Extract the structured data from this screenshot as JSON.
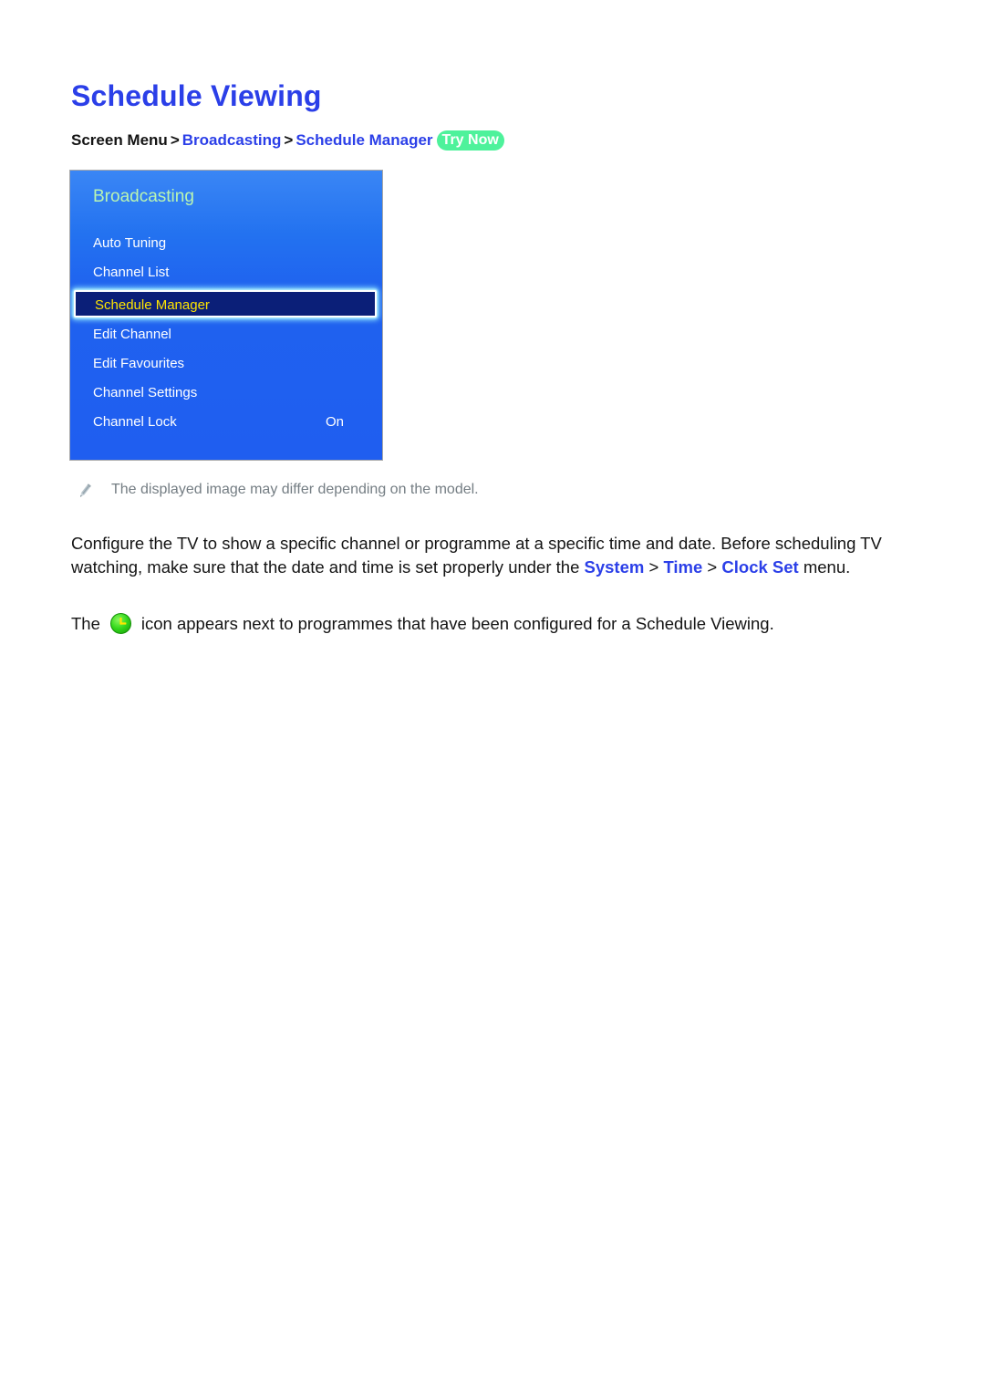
{
  "document": {
    "title": "Schedule Viewing"
  },
  "breadcrumb": {
    "root": "Screen Menu",
    "separator": ">",
    "items": [
      {
        "label": "Broadcasting",
        "style": "link"
      },
      {
        "label": "Schedule Manager",
        "style": "link"
      }
    ],
    "badge": "Try Now"
  },
  "tv_menu": {
    "header": "Broadcasting",
    "items": [
      {
        "label": "Auto Tuning",
        "value": "",
        "selected": false
      },
      {
        "label": "Channel List",
        "value": "",
        "selected": false
      },
      {
        "label": "Schedule Manager",
        "value": "",
        "selected": true
      },
      {
        "label": "Edit Channel",
        "value": "",
        "selected": false
      },
      {
        "label": "Edit Favourites",
        "value": "",
        "selected": false
      },
      {
        "label": "Channel Settings",
        "value": "",
        "selected": false
      },
      {
        "label": "Channel Lock",
        "value": "On",
        "selected": false
      }
    ]
  },
  "note": {
    "icon": "pencil-icon",
    "text": "The displayed image may differ depending on the model."
  },
  "paragraphs": {
    "p1_part1": "Configure the TV to show a specific channel or programme at a specific time and date. Before scheduling TV watching, make sure that the date and time is set properly under the ",
    "p1_link1": "System",
    "p1_sep1": " > ",
    "p1_link2": "Time",
    "p1_sep2": " > ",
    "p1_link3": "Clock Set",
    "p1_part2": " menu.",
    "p2_before": "The",
    "p2_icon": "green-clock-icon",
    "p2_after": "icon appears next to programmes that have been configured for a Schedule Viewing."
  },
  "colors": {
    "title_blue": "#2b3fe8",
    "link_blue": "#2b3fe8",
    "badge_green": "#4ef29b",
    "menu_panel_blue": "#1f62ef",
    "selected_row_bg": "#0b1f78",
    "selected_row_text": "#ffe500",
    "menu_header_green": "#b9f5b2",
    "note_grey": "#747d83",
    "clock_icon_green": "#2fd11a"
  }
}
